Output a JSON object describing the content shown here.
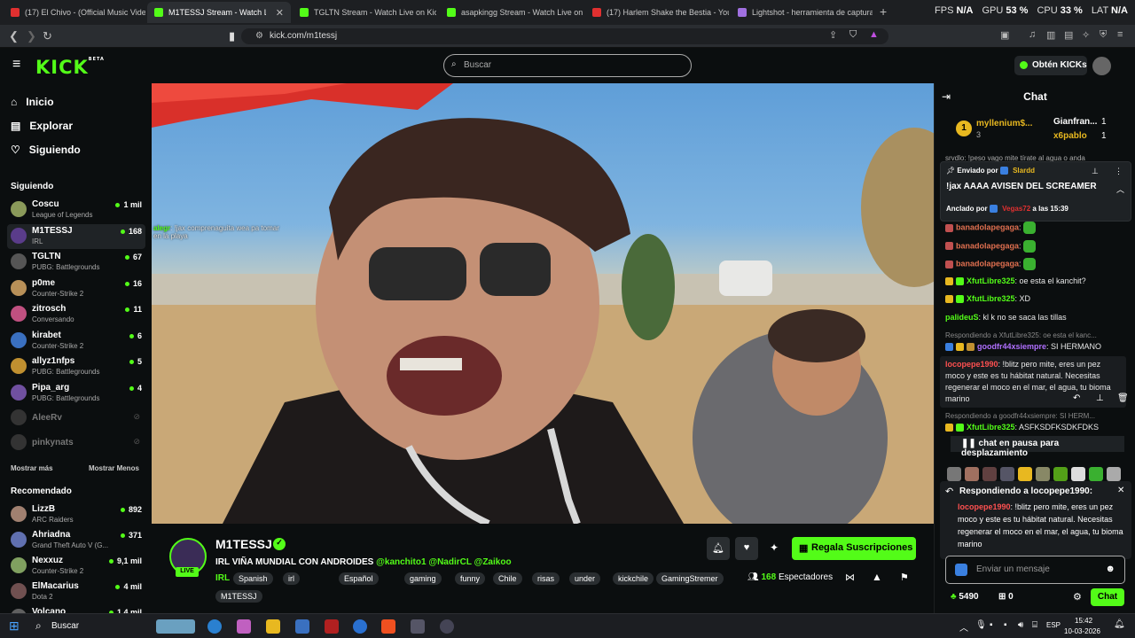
{
  "browser": {
    "tabs": [
      {
        "label": "(17) El Chivo - (Official Music Video)",
        "color": "#e03030"
      },
      {
        "label": "M1TESSJ Stream - Watch Live",
        "color": "#53fc18"
      },
      {
        "label": "TGLTN Stream - Watch Live on Kick",
        "color": "#53fc18"
      },
      {
        "label": "asapkingg Stream - Watch Live on Ki",
        "color": "#53fc18"
      },
      {
        "label": "(17) Harlem Shake the Bestia - YouTu",
        "color": "#e03030"
      },
      {
        "label": "Lightshot - herramienta de captura d",
        "color": "#a070e0"
      }
    ],
    "new_tab": "+",
    "stats": {
      "fps_label": "FPS",
      "fps": "N/A",
      "gpu_label": "GPU",
      "gpu": "53 %",
      "cpu_label": "CPU",
      "cpu": "33 %",
      "lat_label": "LAT",
      "lat": "N/A"
    },
    "url": "kick.com/m1tessj"
  },
  "header": {
    "logo": "KICK",
    "logo_sup": "BETA",
    "search_placeholder": "Buscar",
    "get_kicks": "Obtén KICKs"
  },
  "sidebar": {
    "nav": [
      {
        "label": "Inicio",
        "icon": "home-icon"
      },
      {
        "label": "Explorar",
        "icon": "compass-icon"
      },
      {
        "label": "Siguiendo",
        "icon": "heart-icon"
      }
    ],
    "following_title": "Siguiendo",
    "following": [
      {
        "name": "Coscu",
        "game": "League of Legends",
        "viewers": "1 mil",
        "color": "#8a9a5a"
      },
      {
        "name": "M1TESSJ",
        "game": "IRL",
        "viewers": "168",
        "color": "#5a3c8a"
      },
      {
        "name": "TGLTN",
        "game": "PUBG: Battlegrounds",
        "viewers": "67",
        "color": "#555"
      },
      {
        "name": "p0me",
        "game": "Counter-Strike 2",
        "viewers": "16",
        "color": "#b89058"
      },
      {
        "name": "zitrosch",
        "game": "Conversando",
        "viewers": "11",
        "color": "#c05080"
      },
      {
        "name": "kirabet",
        "game": "Counter-Strike 2",
        "viewers": "6",
        "color": "#3a70c0"
      },
      {
        "name": "allyz1nfps",
        "game": "PUBG: Battlegrounds",
        "viewers": "5",
        "color": "#c09030"
      },
      {
        "name": "Pipa_arg",
        "game": "PUBG: Battlegrounds",
        "viewers": "4",
        "color": "#7050a0"
      }
    ],
    "offline": [
      "AleeRv",
      "pinkynats"
    ],
    "show_more": "Mostrar más",
    "show_less": "Mostrar Menos",
    "recommended_title": "Recomendado",
    "recommended": [
      {
        "name": "LizzB",
        "game": "ARC Raiders",
        "viewers": "892",
        "color": "#a08070"
      },
      {
        "name": "Ahriadna",
        "game": "Grand Theft Auto V (G...",
        "viewers": "371",
        "color": "#6070b0"
      },
      {
        "name": "Nexxuz",
        "game": "Counter-Strike 2",
        "viewers": "9,1 mil",
        "color": "#80a060"
      },
      {
        "name": "ElMacarius",
        "game": "Dota 2",
        "viewers": "4 mil",
        "color": "#705050"
      },
      {
        "name": "Volcano",
        "game": "",
        "viewers": "1,4 mil",
        "color": "#606060"
      }
    ]
  },
  "video": {
    "overlay_user": "alegr",
    "overlay_text": "!jax comprenaguita wea pa tomar",
    "overlay_text2": "en la playa"
  },
  "stream": {
    "name": "M1TESSJ",
    "live": "LIVE",
    "title": "IRL VIÑA MUNDIAL CON ANDROIDES",
    "mentions": "@kanchito1 @NadirCL @Zaikoo",
    "category": "IRL",
    "tags": [
      "Spanish",
      "irl",
      "Español",
      "gaming",
      "funny",
      "Chile",
      "risas",
      "under",
      "kickchile",
      "GamingStremer",
      "M1TESSJ"
    ],
    "subscribe": "Regala Suscripciones",
    "viewers": "168",
    "viewers_label": "Espectadores"
  },
  "chat": {
    "title": "Chat",
    "top_gifters": [
      {
        "name": "myllenium$...",
        "count": "3",
        "rank": "1"
      },
      {
        "name": "Gianfran...",
        "count": "1"
      },
      {
        "name": "x6pablo",
        "count": "1"
      }
    ],
    "partial_msg": "srvdlo: !peso vago mite tírate al agua o anda",
    "pinned": {
      "sent_by_label": "Enviado por",
      "sent_by": "Slardd",
      "text": "!jax AAAA AVISEN DEL SCREAMER",
      "pinned_by_label": "Anclado por",
      "pinned_by": "Vegas72",
      "time_label": "a las 15:39"
    },
    "messages": [
      {
        "user": "banadolapegaga",
        "text": "",
        "color": "#e07050"
      },
      {
        "user": "banadolapegaga",
        "text": "",
        "color": "#e07050"
      },
      {
        "user": "banadolapegaga",
        "text": "",
        "color": "#e07050"
      },
      {
        "user": "XfutLibre325",
        "text": "oe esta el kanchit?",
        "color": "#53fc18"
      },
      {
        "user": "XfutLibre325",
        "text": "XD",
        "color": "#53fc18"
      },
      {
        "user": "palideuS",
        "text": "kl k no se saca las tillas",
        "color": "#53fc18"
      }
    ],
    "reply_context": "Respondiendo a XfutLibre325: oe esta el kanc...",
    "reply_msg": {
      "user": "goodfr44xsiempre",
      "text": "SI HERMANO",
      "color": "#b070ff"
    },
    "loco_msg": {
      "user": "locopepe1990",
      "text": "!blitz pero mite, eres un pez moco y este es tu hábitat natural. Necesitas regenerar el moco en el mar, el agua, tu bioma marino",
      "color": "#ff5050"
    },
    "reply_context2": "Respondiendo a goodfr44xsiempre: SI HERM...",
    "asf_msg": {
      "user": "XfutLibre325",
      "text": "ASFKSDFKSDKFDKS",
      "color": "#53fc18"
    },
    "paused": "chat en pausa para desplazamiento",
    "replying_to_label": "Respondiendo a locopepe1990:",
    "replying_user": "locopepe1990",
    "replying_text": "!blitz pero mite, eres un pez moco y este es tu hábitat natural. Necesitas regenerar el moco en el mar, el agua, tu bioma marino",
    "input_placeholder": "Enviar un mensaje",
    "kicks": "5490",
    "sub_count": "0",
    "send": "Chat"
  },
  "taskbar": {
    "search": "Buscar",
    "lang": "ESP",
    "time": "15:42",
    "date": "10-03-2026"
  }
}
